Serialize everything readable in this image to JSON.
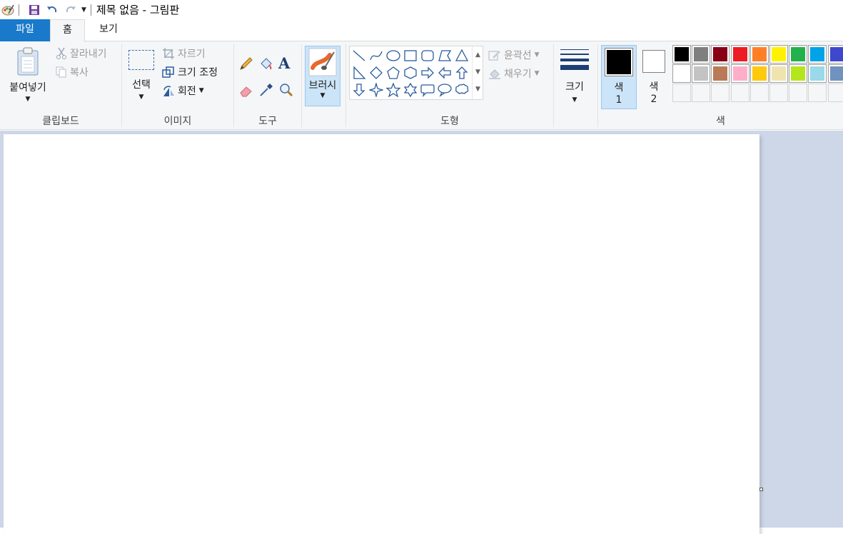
{
  "window": {
    "title": "제목 없음 - 그림판"
  },
  "quick_access": {
    "icons": [
      "paint-app-icon",
      "save-icon",
      "undo-icon",
      "redo-icon",
      "customize-dropdown-icon"
    ]
  },
  "tabs": [
    {
      "label": "파일",
      "active": false
    },
    {
      "label": "홈",
      "active": true
    },
    {
      "label": "보기",
      "active": false
    }
  ],
  "clipboard": {
    "paste": "붙여넣기",
    "cut": "잘라내기",
    "copy": "복사",
    "group": "클립보드"
  },
  "image": {
    "select": "선택",
    "crop": "자르기",
    "resize": "크기 조정",
    "rotate": "회전",
    "group": "이미지"
  },
  "tools": {
    "group": "도구",
    "icons": [
      "pencil-icon",
      "fill-bucket-icon",
      "text-icon",
      "eraser-icon",
      "color-picker-icon",
      "magnifier-icon"
    ]
  },
  "brush": {
    "label": "브러시"
  },
  "shapes": {
    "outline": "윤곽선",
    "fill": "채우기",
    "group": "도형",
    "items": [
      "line",
      "curve",
      "oval",
      "rectangle",
      "rounded-rectangle",
      "polygon",
      "triangle",
      "right-triangle",
      "diamond",
      "pentagon",
      "hexagon",
      "right-arrow",
      "left-arrow",
      "up-arrow",
      "down-arrow",
      "four-point-star",
      "five-point-star",
      "six-point-star",
      "rounded-callout",
      "oval-callout",
      "cloud-callout"
    ]
  },
  "size": {
    "label": "크기"
  },
  "colors": {
    "group": "색",
    "color1_label": "색",
    "color1_num": "1",
    "color2_label": "색",
    "color2_num": "2",
    "color1": "#000000",
    "color2": "#ffffff",
    "palette_row1": [
      "#000000",
      "#7f7f7f",
      "#880015",
      "#ed1c24",
      "#ff7f27",
      "#fff200",
      "#22b14c",
      "#00a2e8",
      "#3f48cc"
    ],
    "palette_row2": [
      "#ffffff",
      "#c3c3c3",
      "#b97a57",
      "#ffaec9",
      "#ffc90e",
      "#efe4b0",
      "#b5e61d",
      "#99d9ea",
      "#7092be"
    ]
  }
}
